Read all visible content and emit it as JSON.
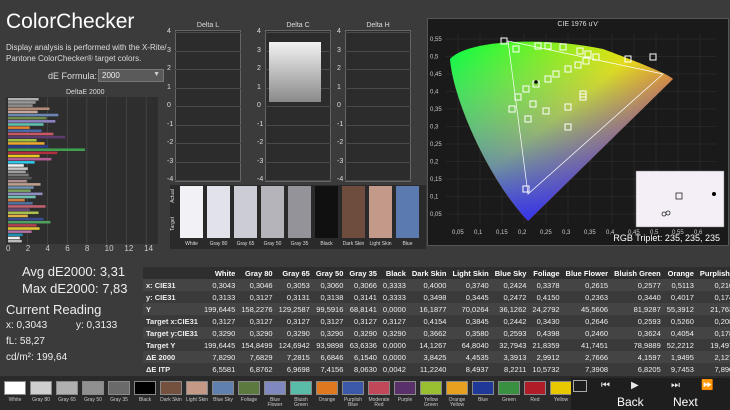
{
  "app": {
    "title": "ColorChecker",
    "description": "Display analysis is performed with the X-Rite/ Pantone ColorChecker® target colors."
  },
  "formula": {
    "label": "dE Formula:",
    "value": "2000"
  },
  "de_chart": {
    "title": "DeltaE 2000",
    "axis_ticks": [
      "0",
      "2",
      "4",
      "6",
      "8",
      "10",
      "12",
      "14"
    ],
    "bars": [
      {
        "value": 3.1,
        "color": "#b0b0b0"
      },
      {
        "value": 2.8,
        "color": "#9a9a9a"
      },
      {
        "value": 2.5,
        "color": "#909090"
      },
      {
        "value": 4.2,
        "color": "#b48a78"
      },
      {
        "value": 3.0,
        "color": "#c9a898"
      },
      {
        "value": 5.1,
        "color": "#6c86b4"
      },
      {
        "value": 3.9,
        "color": "#6e8a4c"
      },
      {
        "value": 4.8,
        "color": "#8c84c0"
      },
      {
        "value": 3.6,
        "color": "#60c0b0"
      },
      {
        "value": 2.2,
        "color": "#e08030"
      },
      {
        "value": 3.4,
        "color": "#4868a8"
      },
      {
        "value": 4.6,
        "color": "#c85864"
      },
      {
        "value": 5.8,
        "color": "#5c3c6c"
      },
      {
        "value": 2.9,
        "color": "#a0c040"
      },
      {
        "value": 3.7,
        "color": "#e8a830"
      },
      {
        "value": 4.1,
        "color": "#2c3c8c"
      },
      {
        "value": 7.8,
        "color": "#40a050"
      },
      {
        "value": 5.0,
        "color": "#b03040"
      },
      {
        "value": 3.2,
        "color": "#e8c820"
      },
      {
        "value": 4.4,
        "color": "#b85c98"
      },
      {
        "value": 2.7,
        "color": "#0888a8"
      },
      {
        "value": 1.6,
        "color": "#f0f0f0"
      },
      {
        "value": 2.0,
        "color": "#c8c8c8"
      },
      {
        "value": 1.8,
        "color": "#a0a0a0"
      },
      {
        "value": 2.1,
        "color": "#7a7a7a"
      },
      {
        "value": 2.4,
        "color": "#555555"
      },
      {
        "value": 1.9,
        "color": "#b09090"
      },
      {
        "value": 3.3,
        "color": "#c0a090"
      },
      {
        "value": 2.6,
        "color": "#7090b0"
      },
      {
        "value": 2.3,
        "color": "#7aa060"
      },
      {
        "value": 3.5,
        "color": "#9090c0"
      },
      {
        "value": 2.8,
        "color": "#70c0b0"
      },
      {
        "value": 1.7,
        "color": "#d08040"
      },
      {
        "value": 2.5,
        "color": "#5070a0"
      },
      {
        "value": 3.8,
        "color": "#c06070"
      },
      {
        "value": 2.2,
        "color": "#6a4a7a"
      },
      {
        "value": 3.1,
        "color": "#a8c050"
      },
      {
        "value": 2.0,
        "color": "#e0b040"
      },
      {
        "value": 3.6,
        "color": "#3a4a90"
      },
      {
        "value": 4.3,
        "color": "#50a060"
      },
      {
        "value": 2.9,
        "color": "#b04050"
      },
      {
        "value": 3.2,
        "color": "#e0c830"
      },
      {
        "value": 2.4,
        "color": "#b070a0"
      },
      {
        "value": 1.5,
        "color": "#2090b0"
      },
      {
        "value": 1.2,
        "color": "#eeeeee"
      },
      {
        "value": 1.4,
        "color": "#bbbbbb"
      }
    ],
    "highlight_index": 20
  },
  "stats": {
    "avg": "Avg dE2000: 3,31",
    "max": "Max dE2000: 7,83",
    "current_reading": "Current Reading",
    "x": "x: 0,3043",
    "y": "y: 0,3133",
    "fl": "fL: 58,27",
    "cd": "cd/m²: 199,64"
  },
  "delta_panels": [
    {
      "title": "Delta L",
      "ticks": [
        "4",
        "3",
        "2",
        "1",
        "0",
        "-1",
        "-2",
        "-3",
        "-4"
      ]
    },
    {
      "title": "Delta C",
      "ticks": [
        "4",
        "3",
        "2",
        "1",
        "0",
        "-1",
        "-2",
        "-3",
        "-4"
      ]
    },
    {
      "title": "Delta H",
      "ticks": [
        "4",
        "3",
        "2",
        "1",
        "0",
        "-1",
        "-2",
        "-3",
        "-4"
      ]
    }
  ],
  "swatches": {
    "actual_label": "Actual",
    "target_label": "Target",
    "items": [
      {
        "name": "White",
        "color": "#f2f2f6"
      },
      {
        "name": "Gray 80",
        "color": "#e2e2ea"
      },
      {
        "name": "Gray 65",
        "color": "#ccccd4"
      },
      {
        "name": "Gray 50",
        "color": "#b4b4ba"
      },
      {
        "name": "Gray 35",
        "color": "#939399"
      },
      {
        "name": "Black",
        "color": "#101010"
      },
      {
        "name": "Dark Skin",
        "color": "#6e4c3e"
      },
      {
        "name": "Light Skin",
        "color": "#c39a8a"
      },
      {
        "name": "Blue",
        "color": "#5a7ab0"
      }
    ]
  },
  "cie": {
    "title": "CIE 1976 u'v'",
    "y_ticks": [
      "0,55",
      "0,5",
      "0,45",
      "0,4",
      "0,35",
      "0,3",
      "0,25",
      "0,2",
      "0,15",
      "0,1",
      "0,05"
    ],
    "x_ticks": [
      "0,05",
      "0,1",
      "0,15",
      "0,2",
      "0,25",
      "0,3",
      "0,35",
      "0,4",
      "0,45",
      "0,5",
      "0,55",
      "0,6"
    ],
    "rgb_triplet": "RGB Triplet: 235, 235, 235"
  },
  "table": {
    "columns": [
      "",
      "White",
      "Gray 80",
      "Gray 65",
      "Gray 50",
      "Gray 35",
      "Black",
      "Dark Skin",
      "Light Skin",
      "Blue Sky",
      "Foliage",
      "Blue Flower",
      "Bluish Green",
      "Orange",
      "Purplish B"
    ],
    "rows": [
      [
        "x: CIE31",
        "0,3043",
        "0,3046",
        "0,3053",
        "0,3060",
        "0,3066",
        "0,3333",
        "0,4000",
        "0,3740",
        "0,2424",
        "0,3378",
        "0,2615",
        "0,2577",
        "0,5113",
        "0,2100"
      ],
      [
        "y: CIE31",
        "0,3133",
        "0,3127",
        "0,3131",
        "0,3138",
        "0,3141",
        "0,3333",
        "0,3498",
        "0,3445",
        "0,2472",
        "0,4150",
        "0,2363",
        "0,3440",
        "0,4017",
        "0,1742"
      ],
      [
        "Y",
        "199,6445",
        "158,2276",
        "129,2587",
        "99,5916",
        "68,8141",
        "0,0000",
        "16,1877",
        "70,0264",
        "36,1262",
        "24,2792",
        "45,5606",
        "81,9287",
        "55,3912",
        "21,7637"
      ],
      [
        "Target x:CIE31",
        "0,3127",
        "0,3127",
        "0,3127",
        "0,3127",
        "0,3127",
        "0,3127",
        "0,4154",
        "0,3845",
        "0,2442",
        "0,3430",
        "0,2646",
        "0,2593",
        "0,5260",
        "0,2083"
      ],
      [
        "Target y:CIE31",
        "0,3290",
        "0,3290",
        "0,3290",
        "0,3290",
        "0,3290",
        "0,3290",
        "0,3662",
        "0,3580",
        "0,2593",
        "0,4398",
        "0,2460",
        "0,3624",
        "0,4054",
        "0,1782"
      ],
      [
        "Target Y",
        "199,6445",
        "154,8499",
        "124,6942",
        "93,9898",
        "63,6336",
        "0,0000",
        "14,1267",
        "64,8040",
        "32,7943",
        "21,8359",
        "41,7451",
        "78,9889",
        "52,2212",
        "19,4978"
      ],
      [
        "ΔE 2000",
        "7,8290",
        "7,6829",
        "7,2815",
        "6,6846",
        "6,1540",
        "0,0000",
        "3,8425",
        "4,4535",
        "3,3913",
        "2,9912",
        "2,7666",
        "4,1597",
        "1,9495",
        "2,1278"
      ],
      [
        "ΔE ITP",
        "6,5581",
        "6,8762",
        "6,9698",
        "7,4156",
        "8,0630",
        "0,0042",
        "11,2240",
        "8,4937",
        "8,2211",
        "10,5732",
        "7,3908",
        "6,8205",
        "9,7453",
        "7,8907"
      ]
    ]
  },
  "bottom_bar": {
    "items": [
      {
        "name": "White",
        "color": "#ffffff"
      },
      {
        "name": "Gray 80",
        "color": "#cfcfcf"
      },
      {
        "name": "Gray 65",
        "color": "#b0b0b0"
      },
      {
        "name": "Gray 50",
        "color": "#909090"
      },
      {
        "name": "Gray 35",
        "color": "#6a6a6a"
      },
      {
        "name": "Black",
        "color": "#000000"
      },
      {
        "name": "Dark Skin",
        "color": "#74503f"
      },
      {
        "name": "Light Skin",
        "color": "#c49a86"
      },
      {
        "name": "Blue Sky",
        "color": "#6080b0"
      },
      {
        "name": "Foliage",
        "color": "#5c7a40"
      },
      {
        "name": "Blue Flower",
        "color": "#8088c0"
      },
      {
        "name": "Bluish Green",
        "color": "#58bca8"
      },
      {
        "name": "Orange",
        "color": "#e07820"
      },
      {
        "name": "Purplish Blue",
        "color": "#3c58a8"
      },
      {
        "name": "Moderate Red",
        "color": "#c04858"
      },
      {
        "name": "Purple",
        "color": "#5a306a"
      },
      {
        "name": "Yellow Green",
        "color": "#98c030"
      },
      {
        "name": "Orange Yellow",
        "color": "#e8a020"
      },
      {
        "name": "Blue",
        "color": "#203898"
      },
      {
        "name": "Green",
        "color": "#389040"
      },
      {
        "name": "Red",
        "color": "#b01c28"
      },
      {
        "name": "Yellow",
        "color": "#e8c800"
      }
    ],
    "back_label": "Back",
    "next_label": "Next"
  }
}
